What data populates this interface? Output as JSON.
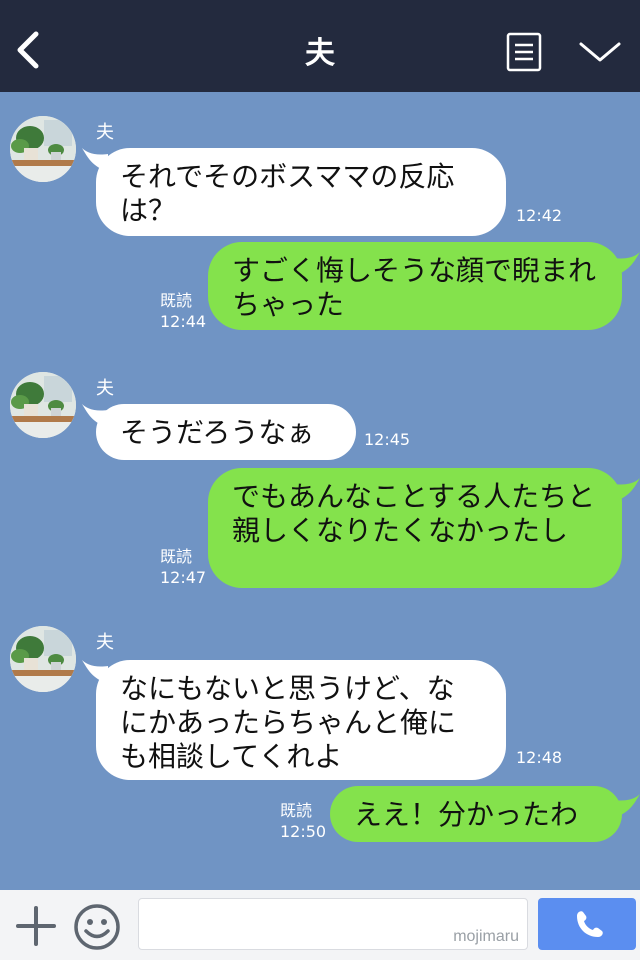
{
  "header": {
    "title": "夫",
    "back_icon": "chevron-left-icon",
    "menu_icon": "list-icon",
    "expand_icon": "chevron-down-icon"
  },
  "messages": [
    {
      "sender": "夫",
      "text": "それでそのボスママの反応は？",
      "time": "12:42"
    },
    {
      "text": "すごく悔しそうな顔で睨まれちゃった",
      "read": "既読",
      "time": "12:44"
    },
    {
      "sender": "夫",
      "text": "そうだろうなぁ",
      "time": "12:45"
    },
    {
      "text": "でもあんなことする人たちと親しくなりたくなかったし",
      "read": "既読",
      "time": "12:47"
    },
    {
      "sender": "夫",
      "text": "なにもないと思うけど、なにかあったらちゃんと俺にも相談してくれよ",
      "time": "12:48"
    },
    {
      "text": "ええ！分かったわ",
      "read": "既読",
      "time": "12:50"
    }
  ],
  "input_bar": {
    "watermark": "mojimaru",
    "plus_icon": "plus-icon",
    "emoji_icon": "smiley-icon",
    "call_icon": "phone-icon"
  },
  "colors": {
    "header": "#232a3e",
    "background": "#7094c4",
    "outgoing": "#84e24c",
    "incoming": "#ffffff",
    "call_button": "#5b8ef0"
  }
}
